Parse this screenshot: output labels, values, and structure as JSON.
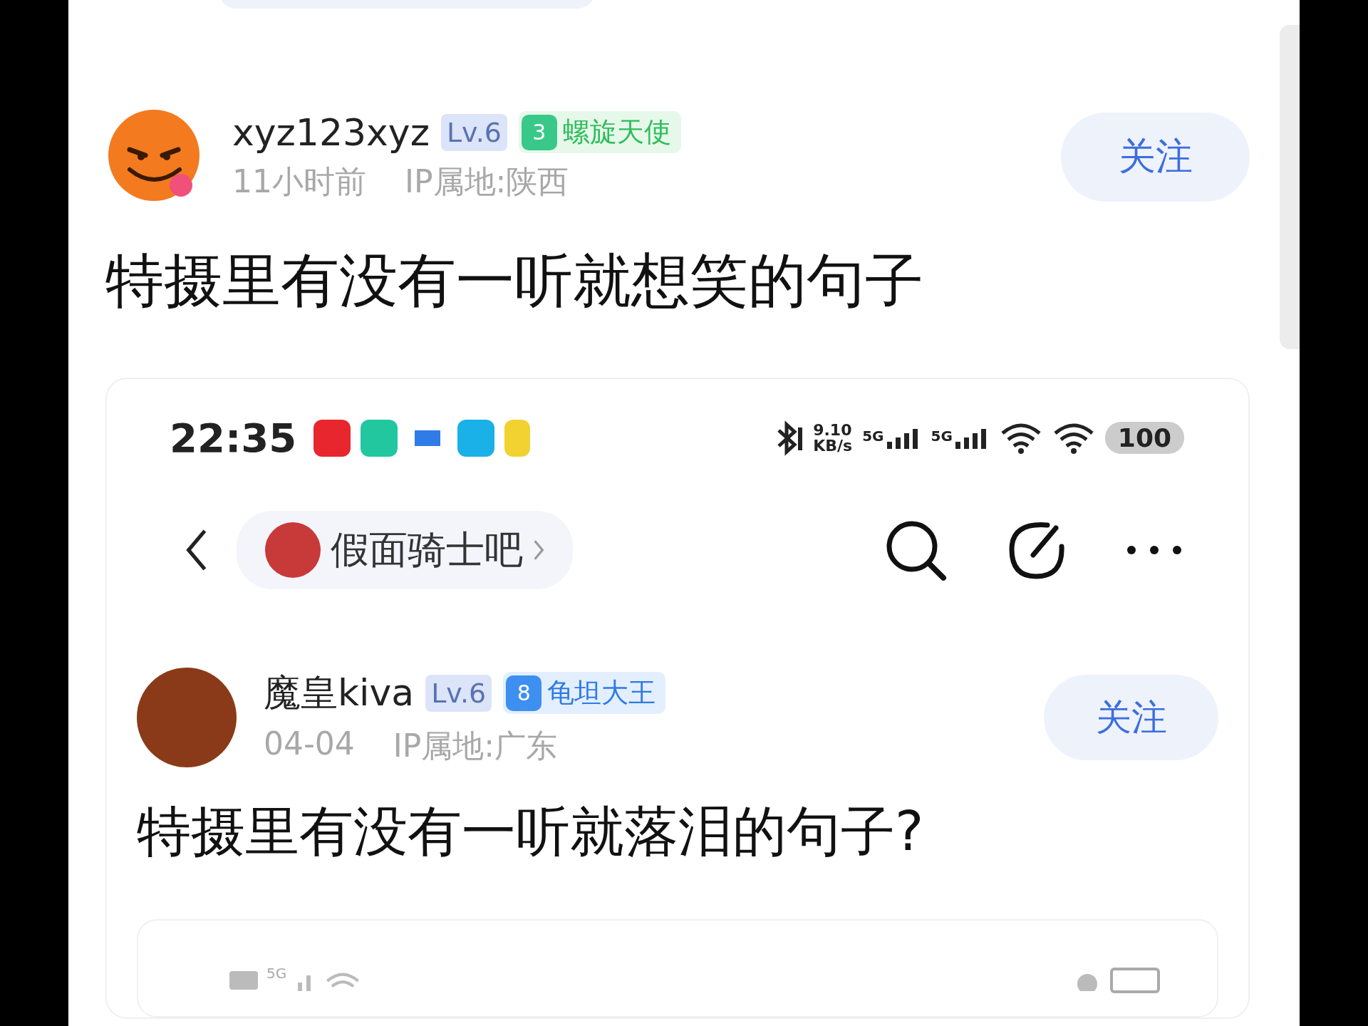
{
  "post": {
    "author": {
      "name": "xyz123xyz",
      "level": "Lv.6",
      "badge_number": "3",
      "badge_title": "螺旋天使",
      "time": "11小时前",
      "ip": "IP属地:陕西"
    },
    "follow_button": "关注",
    "title": "特摄里有没有一听就想笑的句子"
  },
  "screenshot": {
    "status_bar": {
      "time": "22:35",
      "speed": "9.10",
      "speed_unit": "KB/s",
      "network_1": "5G",
      "network_2": "5G",
      "battery": "100"
    },
    "forum": {
      "name": "假面骑士吧"
    },
    "post": {
      "author": {
        "name": "魔皇kiva",
        "level": "Lv.6",
        "badge_number": "8",
        "badge_title": "龟坦大王",
        "time": "04-04",
        "ip": "IP属地:广东"
      },
      "follow_button": "关注",
      "title": "特摄里有没有一听就落泪的句子?"
    },
    "inner_screenshot": {
      "network": "5G"
    }
  }
}
